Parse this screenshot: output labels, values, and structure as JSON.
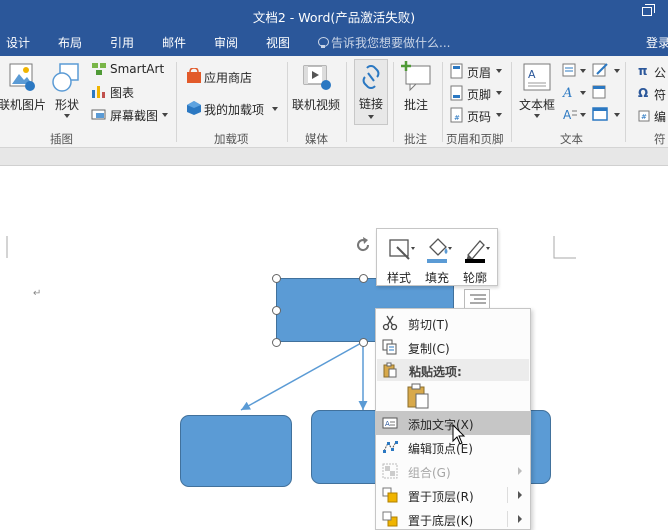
{
  "window": {
    "title": "文档2 - Word(产品激活失败)"
  },
  "tabs": [
    "设计",
    "布局",
    "引用",
    "邮件",
    "审阅",
    "视图"
  ],
  "tell_me": {
    "placeholder": "告诉我您想要做什么..."
  },
  "account": {
    "label": "登录"
  },
  "ribbon": {
    "illustrations": {
      "group_label": "插图",
      "online_pictures": "联机图片",
      "shapes": "形状",
      "smartart": "SmartArt",
      "chart": "图表",
      "screenshot": "屏幕截图"
    },
    "addins": {
      "group_label": "加载项",
      "store": "应用商店",
      "my_addins": "我的加载项"
    },
    "media": {
      "group_label": "媒体",
      "online_video": "联机视频"
    },
    "links": {
      "link": "链接"
    },
    "comments": {
      "group_label": "批注",
      "comment": "批注"
    },
    "header_footer": {
      "group_label": "页眉和页脚",
      "header": "页眉",
      "footer": "页脚",
      "page_number": "页码"
    },
    "text": {
      "group_label": "文本",
      "textbox": "文本框"
    },
    "symbols": {
      "group_label": "符",
      "equation": "公",
      "symbol": "符",
      "number": "编"
    }
  },
  "mini_toolbar": {
    "style": "样式",
    "fill": "填充",
    "outline": "轮廓"
  },
  "context_menu": {
    "cut": "剪切(T)",
    "copy": "复制(C)",
    "paste_options": "粘贴选项:",
    "add_text": "添加文字(X)",
    "edit_points": "编辑顶点(E)",
    "group": "组合(G)",
    "bring_to_front": "置于顶层(R)",
    "send_to_back": "置于底层(K)"
  },
  "colors": {
    "title_bar": "#2b579a",
    "shape_fill": "#5b9bd5",
    "shape_border": "#41719c",
    "menu_highlight": "#c6c6c6"
  }
}
